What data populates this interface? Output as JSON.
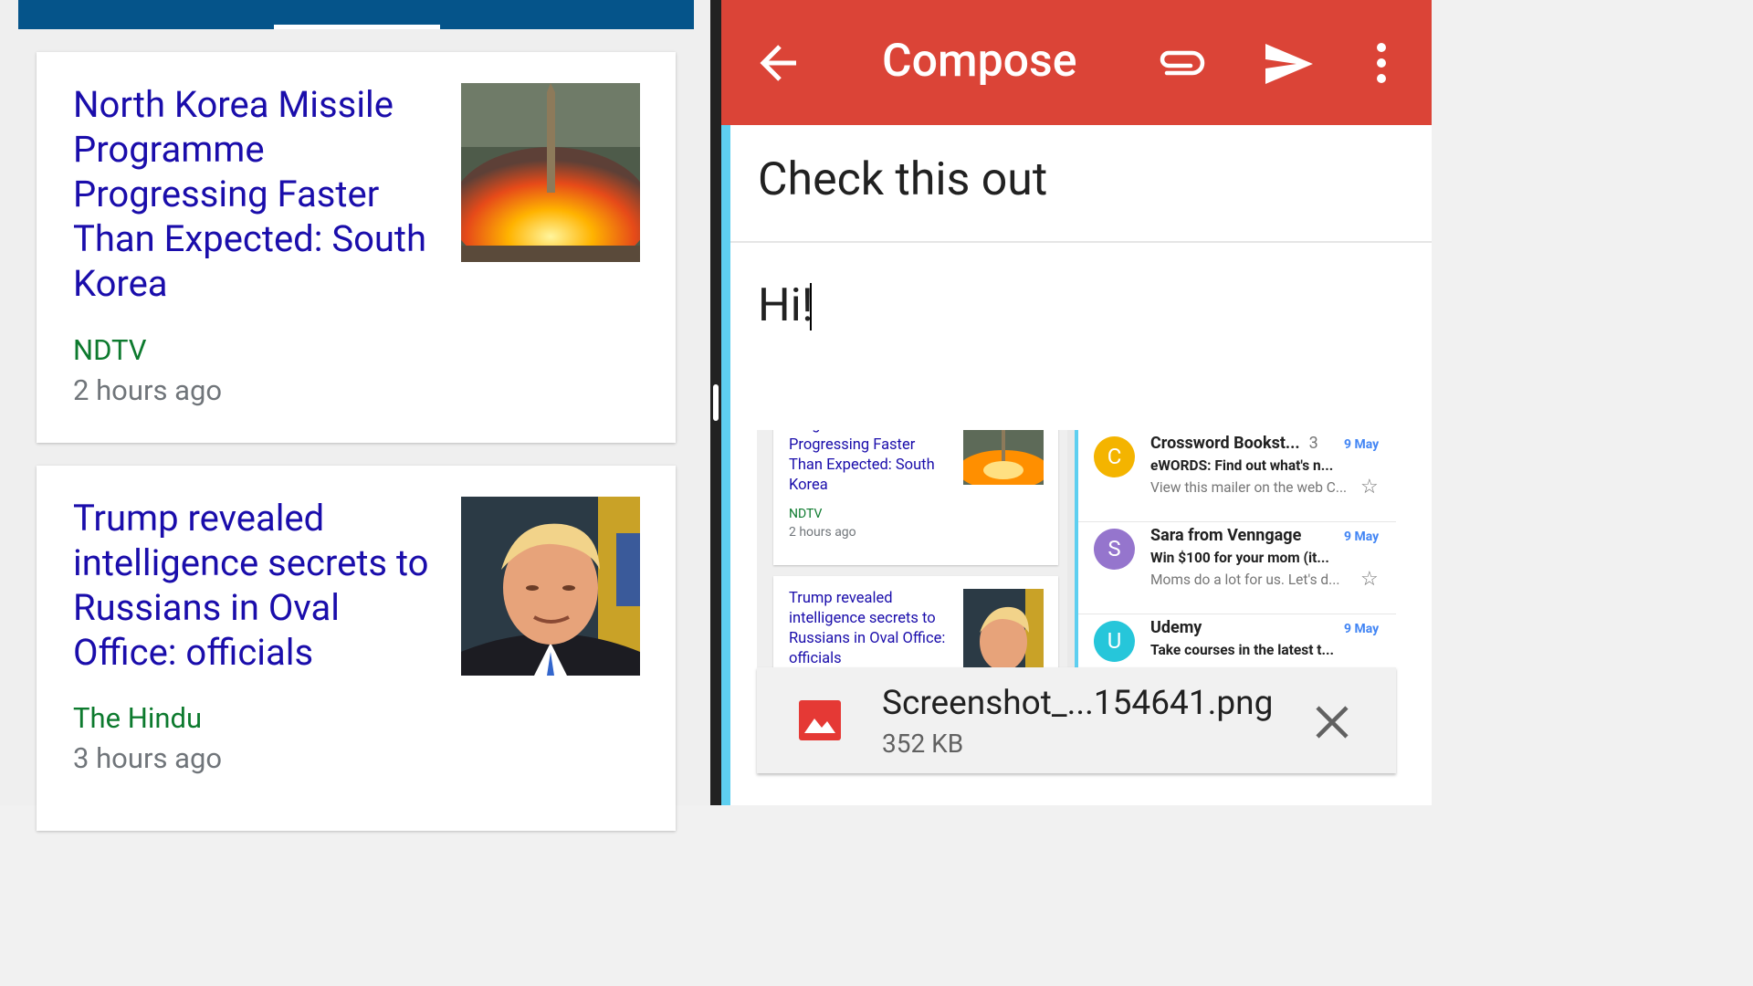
{
  "news": {
    "cards": [
      {
        "title": "North Korea Missile Programme Progressing Faster Than Expected: South Korea",
        "source": "NDTV",
        "time": "2 hours ago"
      },
      {
        "title": "Trump revealed intelligence secrets to Russians in Oval Office: officials",
        "source": "The Hindu",
        "time": "3 hours ago"
      }
    ],
    "colors": {
      "topbar": "#05548a",
      "title": "#1a0dab",
      "source": "#0d7a2e"
    }
  },
  "compose": {
    "title": "Compose",
    "subject": "Check this out",
    "body": "Hi!",
    "icons": [
      "back-arrow-icon",
      "paperclip-icon",
      "send-icon",
      "more-vert-icon"
    ],
    "colors": {
      "bar": "#db4437"
    }
  },
  "preview": {
    "news": [
      {
        "title": "Programme Progressing Faster Than Expected: South Korea",
        "source": "NDTV",
        "time": "2 hours ago"
      },
      {
        "title": "Trump revealed intelligence secrets to Russians in Oval Office: officials"
      }
    ],
    "mails": [
      {
        "avatar": "C",
        "avatar_color": "#f4b400",
        "sender": "Crossword Bookst...",
        "count": "3",
        "date": "9 May",
        "subject": "eWORDS: Find out what's n...",
        "snippet": "View this mailer on the web C..."
      },
      {
        "avatar": "S",
        "avatar_color": "#9575cd",
        "sender": "Sara from Venngage",
        "date": "9 May",
        "subject": "Win $100 for your mom (it...",
        "snippet": "Moms do a lot for us. Let's d..."
      },
      {
        "avatar": "U",
        "avatar_color": "#26c6da",
        "sender": "Udemy",
        "date": "9 May",
        "subject": "Take courses in the latest t..."
      }
    ]
  },
  "attachment": {
    "name": "Screenshot_...154641.png",
    "size": "352 KB",
    "icon": "image-icon"
  }
}
